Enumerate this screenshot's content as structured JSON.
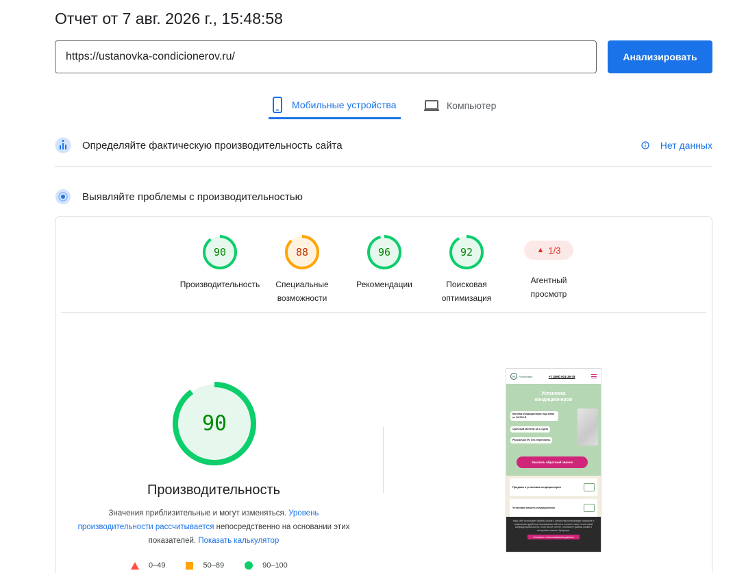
{
  "header": {
    "title": "Отчет от 7 авг. 2026 г., 15:48:58"
  },
  "search": {
    "url_value": "https://ustanovka-condicionerov.ru/",
    "analyze_label": "Анализировать"
  },
  "tabs": [
    {
      "label": "Мобильные устройства",
      "icon": "smartphone-icon",
      "active": true
    },
    {
      "label": "Компьютер",
      "icon": "laptop-icon",
      "active": false
    }
  ],
  "field_data": {
    "title": "Определяйте фактическую производительность сайта",
    "status": "Нет данных",
    "status_icon": "info-icon"
  },
  "lab_data": {
    "title": "Выявляйте проблемы с производительностью"
  },
  "scores": [
    {
      "value": "90",
      "label": "Производительность",
      "color": "#0cce6b",
      "text_color": "#008800",
      "bg": "#e6f8ee",
      "fraction": 0.9
    },
    {
      "value": "88",
      "label": "Специальные возможности",
      "color": "#ffa400",
      "text_color": "#c33300",
      "bg": "#fff3e0",
      "fraction": 0.88
    },
    {
      "value": "96",
      "label": "Рекомендации",
      "color": "#0cce6b",
      "text_color": "#008800",
      "bg": "#e6f8ee",
      "fraction": 0.96
    },
    {
      "value": "92",
      "label": "Поисковая оптимизация",
      "color": "#0cce6b",
      "text_color": "#008800",
      "bg": "#e6f8ee",
      "fraction": 0.92
    }
  ],
  "agent": {
    "value": "1/3",
    "label": "Агентный просмотр"
  },
  "performance": {
    "score": "90",
    "fraction": 0.9,
    "title": "Производительность",
    "desc_1": "Значения приблизительные и могут изменяться. ",
    "link_1": "Уровень производительности рассчитывается",
    "desc_2": " непосредственно на основании этих показателей. ",
    "link_2": "Показать калькулятор"
  },
  "legend": [
    {
      "range": "0–49",
      "shape": "triangle",
      "color": "#ff4e42"
    },
    {
      "range": "50–89",
      "shape": "square",
      "color": "#ffa400"
    },
    {
      "range": "90–100",
      "shape": "circle",
      "color": "#0cce6b"
    }
  ],
  "thumbnail": {
    "logo_letters": "РК",
    "logo_text": "РосКлимат",
    "phone": "+7 (495) 001-35-78",
    "hero_title": "Установка кондиционеров",
    "pills": [
      "Монтаж кондиционера под ключ от 18 000 ₽",
      "Срочный монтаж за 2-4 дня",
      "Рассрочка 0% без переплаты"
    ],
    "cta": "Заказать обратный звонок",
    "cards": [
      "Продажа и установка кондиционеров",
      "Установка вашего кондиционера"
    ],
    "footer_text": "Наш сайт использует файлы cookie с целью персонализации сервисов и повышения удобства пользования сайтом в соответствии с политикой конфиденциальности. Если вы не хотите, отключите файлы cookie в настройках вашего браузера.",
    "footer_btn": "Согласен с использованием данных"
  }
}
